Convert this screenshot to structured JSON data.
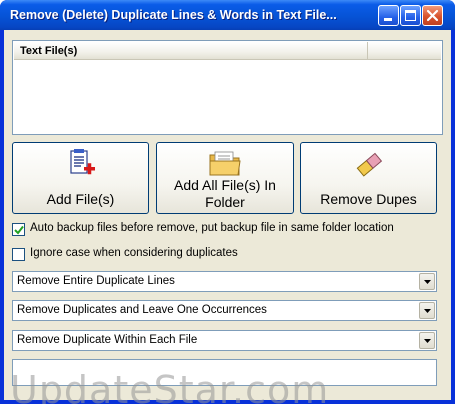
{
  "window": {
    "title": "Remove (Delete) Duplicate Lines & Words in Text File..."
  },
  "file_list": {
    "columns": [
      "Text File(s)",
      ""
    ],
    "rows": []
  },
  "buttons": {
    "add_files": "Add File(s)",
    "add_folder": "Add All File(s) In Folder",
    "remove_dupes": "Remove Dupes"
  },
  "options": {
    "auto_backup": {
      "label": "Auto backup files before remove, put backup file in same folder location",
      "checked": true
    },
    "ignore_case": {
      "label": "Ignore case when considering duplicates",
      "checked": false
    }
  },
  "dropdowns": {
    "mode": "Remove Entire Duplicate Lines",
    "occurrence": "Remove Duplicates and Leave One Occurrences",
    "scope": "Remove Duplicate Within Each File"
  },
  "watermark": "UpdateStar.com",
  "colors": {
    "titlebar": "#0653d6",
    "face": "#ece9d8",
    "close": "#d8532d"
  }
}
